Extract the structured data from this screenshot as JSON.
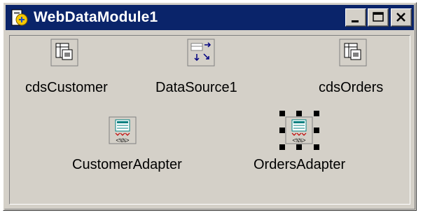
{
  "window": {
    "title": "WebDataModule1"
  },
  "components": [
    {
      "label": "cdsCustomer",
      "icon": "client-dataset-icon"
    },
    {
      "label": "DataSource1",
      "icon": "datasource-icon"
    },
    {
      "label": "cdsOrders",
      "icon": "client-dataset-icon"
    },
    {
      "label": "CustomerAdapter",
      "icon": "dataset-adapter-icon"
    },
    {
      "label": "OrdersAdapter",
      "icon": "dataset-adapter-icon",
      "selected": true
    }
  ],
  "colors": {
    "titlebar": "#0a246a",
    "face": "#d4d0c8"
  }
}
